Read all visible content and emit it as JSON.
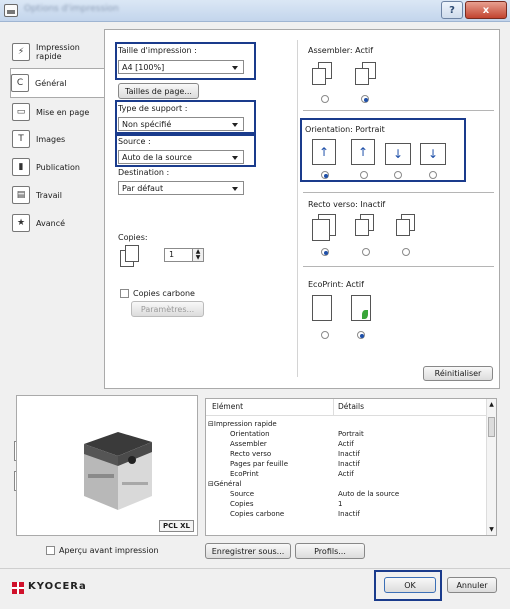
{
  "window": {
    "title": "Options d'impression",
    "help_label": "?",
    "close_label": "x"
  },
  "tabs": [
    {
      "id": "quick",
      "label": "Impression rapide",
      "icon": "quick-print-icon"
    },
    {
      "id": "general",
      "label": "Général",
      "icon": "general-icon"
    },
    {
      "id": "layout",
      "label": "Mise en page",
      "icon": "layout-icon"
    },
    {
      "id": "images",
      "label": "Images",
      "icon": "images-icon"
    },
    {
      "id": "publishing",
      "label": "Publication",
      "icon": "publishing-icon"
    },
    {
      "id": "job",
      "label": "Travail",
      "icon": "job-icon"
    },
    {
      "id": "advanced",
      "label": "Avancé",
      "icon": "advanced-icon"
    }
  ],
  "general": {
    "paper_size_label": "Taille d'impression :",
    "paper_size_value": "A4 [100%]",
    "page_sizes_button": "Tailles de page...",
    "media_type_label": "Type de support :",
    "media_type_value": "Non spécifié",
    "source_label": "Source :",
    "source_value": "Auto de la source",
    "destination_label": "Destination :",
    "destination_value": "Par défaut",
    "copies_label": "Copies:",
    "copies_value": "1",
    "carbon_label": "Copies carbone",
    "settings_button": "Paramètres...",
    "collate_label": "Assembler: Actif",
    "orientation_label": "Orientation: Portrait",
    "duplex_label": "Recto verso: Inactif",
    "ecoprint_label": "EcoPrint: Actif",
    "reset_button": "Réinitialiser"
  },
  "summary": {
    "col_item": "Elément",
    "col_details": "Détails",
    "rows": [
      {
        "item": "Impression rapide",
        "detail": "",
        "group": true
      },
      {
        "item": "Orientation",
        "detail": "Portrait"
      },
      {
        "item": "Assembler",
        "detail": "Actif"
      },
      {
        "item": "Recto verso",
        "detail": "Inactif"
      },
      {
        "item": "Pages par feuille",
        "detail": "Inactif"
      },
      {
        "item": "EcoPrint",
        "detail": "Actif"
      },
      {
        "item": "Général",
        "detail": "",
        "group": true
      },
      {
        "item": "Source",
        "detail": "Auto de la source"
      },
      {
        "item": "Copies",
        "detail": "1"
      },
      {
        "item": "Copies carbone",
        "detail": "Inactif"
      }
    ]
  },
  "footer": {
    "preview_check_label": "Aperçu avant impression",
    "save_as_button": "Enregistrer sous...",
    "profiles_button": "Profils...",
    "pcl_badge": "PCL XL",
    "logo_text": "KYOCERa",
    "ok_button": "OK",
    "cancel_button": "Annuler"
  },
  "colors": {
    "highlight": "#1a3b8c",
    "accent": "#1e4fa8",
    "logo_red": "#d0112b"
  }
}
